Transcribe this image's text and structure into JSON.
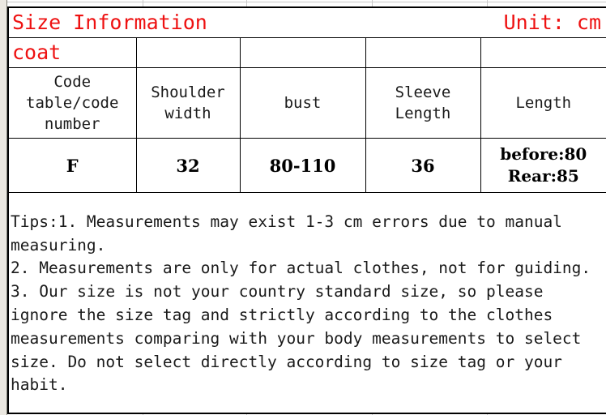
{
  "document": {
    "title": "Size Information",
    "unit_label": "Unit: cm",
    "garment": "coat",
    "title_color": "#ee1111"
  },
  "table": {
    "columns": [
      "Code table/code number",
      "Shoulder width",
      "bust",
      "Sleeve Length",
      "Length"
    ],
    "rows": [
      {
        "code": "F",
        "shoulder_width": "32",
        "bust": "80-110",
        "sleeve_length": "36",
        "length_line1": "before:80",
        "length_line2": "Rear:85"
      }
    ]
  },
  "tips": {
    "text": "Tips:1. Measurements may exist 1-3 cm errors due to manual measuring.\n2. Measurements are only for actual clothes, not for guiding.\n3. Our size is not your country standard size, so please ignore the size tag and strictly according to the clothes measurements comparing with your body measurements to select size. Do not select directly according to size tag or your habit."
  }
}
